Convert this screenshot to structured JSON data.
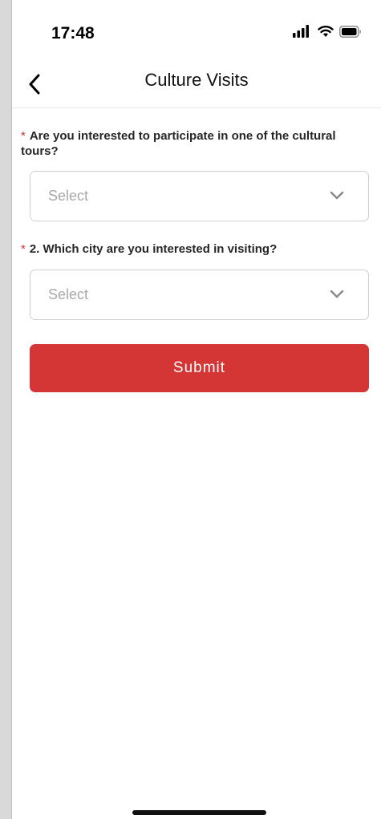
{
  "status_bar": {
    "time": "17:48",
    "icons": [
      "signal-icon",
      "wifi-icon",
      "battery-icon"
    ]
  },
  "nav": {
    "title": "Culture Visits",
    "back_icon": "chevron-left-icon"
  },
  "form": {
    "questions": [
      {
        "required_mark": "*",
        "label": "Are you interested to participate in one of the cultural tours?",
        "placeholder": "Select"
      },
      {
        "required_mark": "*",
        "label": "2. Which city are you interested in visiting?",
        "placeholder": "Select"
      }
    ],
    "submit_label": "Submit"
  },
  "colors": {
    "accent": "#d43535",
    "required": "#d23232",
    "placeholder": "#a8a8a8",
    "border": "#cfcfcf"
  }
}
